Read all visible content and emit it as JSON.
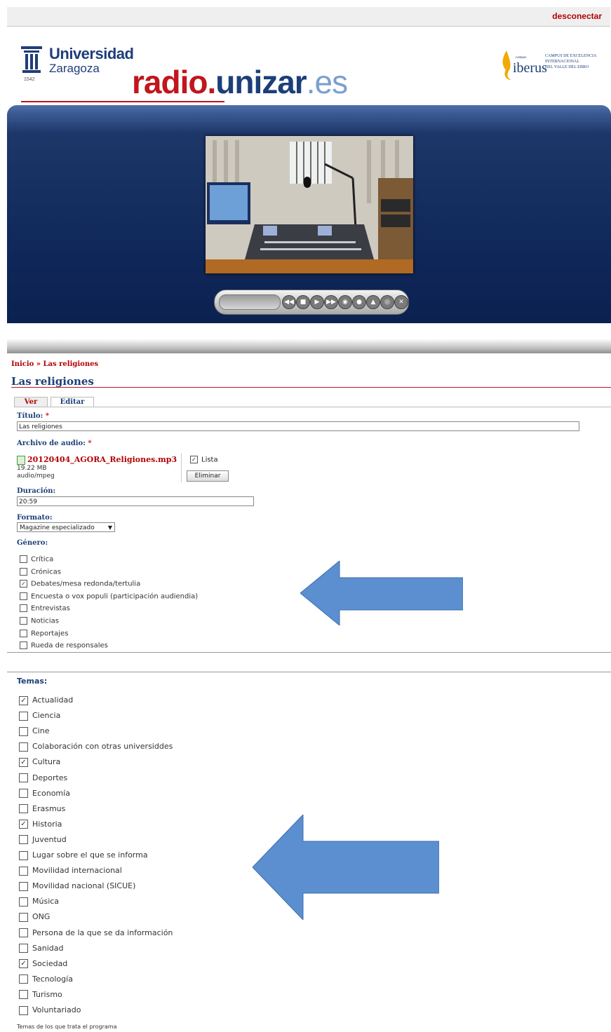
{
  "topbar": {
    "logout_label": "desconectar"
  },
  "header": {
    "university_line1": "Universidad",
    "university_line2": "Zaragoza",
    "university_year": "1542",
    "brand_part1": "radio.",
    "brand_part2": "unizar",
    "brand_part3": ".es",
    "iberus_campus": "campus",
    "iberus_word": "iberus",
    "iberus_tagline": [
      "CAMPUS DE EXCELENCIA",
      "INTERNACIONAL",
      "DEL VALLE DEL EBRO"
    ]
  },
  "breadcrumb": "Inicio » Las religiones",
  "page_title": "Las religiones",
  "tabs": [
    {
      "label": "Ver"
    },
    {
      "label": "Editar"
    }
  ],
  "form": {
    "titulo_label": "Título:",
    "titulo_value": "Las religiones",
    "required_mark": "*",
    "audio_label": "Archivo de audio:",
    "audio_file": "20120404_AGORA_Religiones.mp3",
    "audio_size": "19.22 MB",
    "audio_type": "audio/mpeg",
    "lista_label": "Lista",
    "delete_label": "Eliminar",
    "duracion_label": "Duración:",
    "duracion_value": "20:59",
    "formato_label": "Formato:",
    "formato_value": "Magazine especializado",
    "genero_label": "Género:",
    "genero_options": [
      {
        "label": "Crítica",
        "checked": false
      },
      {
        "label": "Crónicas",
        "checked": false
      },
      {
        "label": "Debates/mesa redonda/tertulia",
        "checked": true
      },
      {
        "label": "Encuesta o vox populi (participación audiendia)",
        "checked": false
      },
      {
        "label": "Entrevistas",
        "checked": false
      },
      {
        "label": "Noticias",
        "checked": false
      },
      {
        "label": "Reportajes",
        "checked": false
      },
      {
        "label": "Rueda de responsales",
        "checked": false
      }
    ],
    "temas_label": "Temas:",
    "temas_options": [
      {
        "label": "Actualidad",
        "checked": true
      },
      {
        "label": "Ciencia",
        "checked": false
      },
      {
        "label": "Cine",
        "checked": false
      },
      {
        "label": "Colaboración con otras universiddes",
        "checked": false
      },
      {
        "label": "Cultura",
        "checked": true
      },
      {
        "label": "Deportes",
        "checked": false
      },
      {
        "label": "Economía",
        "checked": false
      },
      {
        "label": "Erasmus",
        "checked": false
      },
      {
        "label": "Historia",
        "checked": true
      },
      {
        "label": "Juventud",
        "checked": false
      },
      {
        "label": "Lugar sobre el que se informa",
        "checked": false
      },
      {
        "label": "Movilidad internacional",
        "checked": false
      },
      {
        "label": "Movilidad nacional (SICUE)",
        "checked": false
      },
      {
        "label": "Música",
        "checked": false
      },
      {
        "label": "ONG",
        "checked": false
      },
      {
        "label": "Persona de la que se da información",
        "checked": false
      },
      {
        "label": "Sanidad",
        "checked": false
      },
      {
        "label": "Sociedad",
        "checked": true
      },
      {
        "label": "Tecnología",
        "checked": false
      },
      {
        "label": "Turismo",
        "checked": false
      },
      {
        "label": "Voluntariado",
        "checked": false
      }
    ],
    "temas_help": "Temas de los que trata el programa"
  },
  "player": {
    "buttons": [
      "rewind-icon",
      "stop-icon",
      "play-icon",
      "forward-icon",
      "volume-icon",
      "zoom-icon",
      "eject-icon",
      "record-icon",
      "close-icon"
    ]
  },
  "colors": {
    "brand_red": "#c1161d",
    "brand_blue": "#1c3f78",
    "arrow_blue": "#5b8fd0"
  }
}
